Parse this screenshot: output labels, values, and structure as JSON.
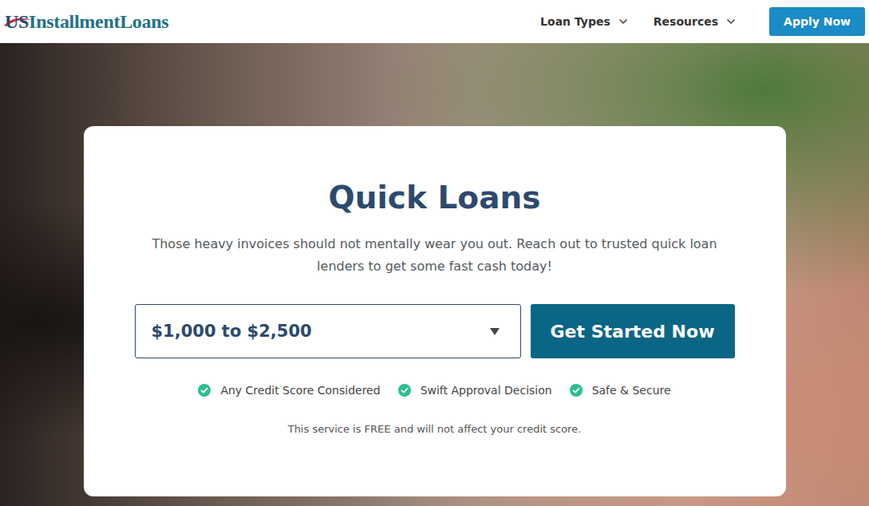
{
  "header": {
    "logo": {
      "prefix": "US",
      "name": "InstallmentLoans"
    },
    "nav": [
      {
        "label": "Loan Types"
      },
      {
        "label": "Resources"
      }
    ],
    "cta": "Apply Now"
  },
  "card": {
    "title": "Quick Loans",
    "subtitle": "Those heavy invoices should not mentally wear you out. Reach out to trusted quick loan lenders to get some fast cash today!",
    "amount": "$1,000 to $2,500",
    "button": "Get Started Now",
    "features": [
      "Any Credit Score Considered",
      "Swift Approval Decision",
      "Safe & Secure"
    ],
    "disclaimer": "This service is FREE and will not affect your credit score."
  }
}
